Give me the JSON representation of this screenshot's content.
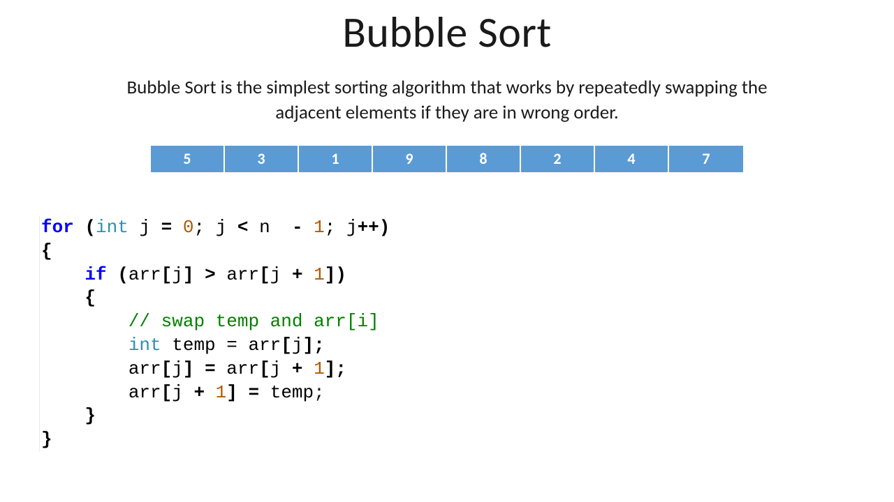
{
  "title": "Bubble Sort",
  "description": "Bubble Sort is the simplest sorting algorithm that works by repeatedly swapping the adjacent elements if they are in wrong order.",
  "array": [
    "5",
    "3",
    "1",
    "9",
    "8",
    "2",
    "4",
    "7"
  ],
  "code": {
    "kw_for": "for",
    "kw_if": "if",
    "type_int": "int",
    "num_0": "0",
    "num_1a": "1",
    "num_1b": "1",
    "num_1c": "1",
    "num_1d": "1",
    "comment": "// swap temp and arr[i]",
    "line_temp_assign": "int",
    "id_j": "j",
    "id_n": "n",
    "id_arr": "arr",
    "id_temp": "temp",
    "frag_for_open": " (",
    "frag_int_sp": " ",
    "frag_eq": " = ",
    "frag_semi_sp": "; ",
    "frag_lt": " < ",
    "frag_minus": "  - ",
    "frag_semijpp": "; j",
    "frag_pp_close": "++)",
    "frag_if_open": " (",
    "frag_sub_open": "[",
    "frag_sub_close_gt": "] > ",
    "frag_sub_close_sp": "] ",
    "frag_plus": " + ",
    "frag_sub_close_paren": "])",
    "frag_sub_close_semi": "];",
    "frag_sub_close_eq": "] = ",
    "frag_open_brace": "{",
    "frag_close_brace": "}",
    "frag_eq_temp_semi": " = temp;",
    "frag_temp_eq": " temp = "
  }
}
